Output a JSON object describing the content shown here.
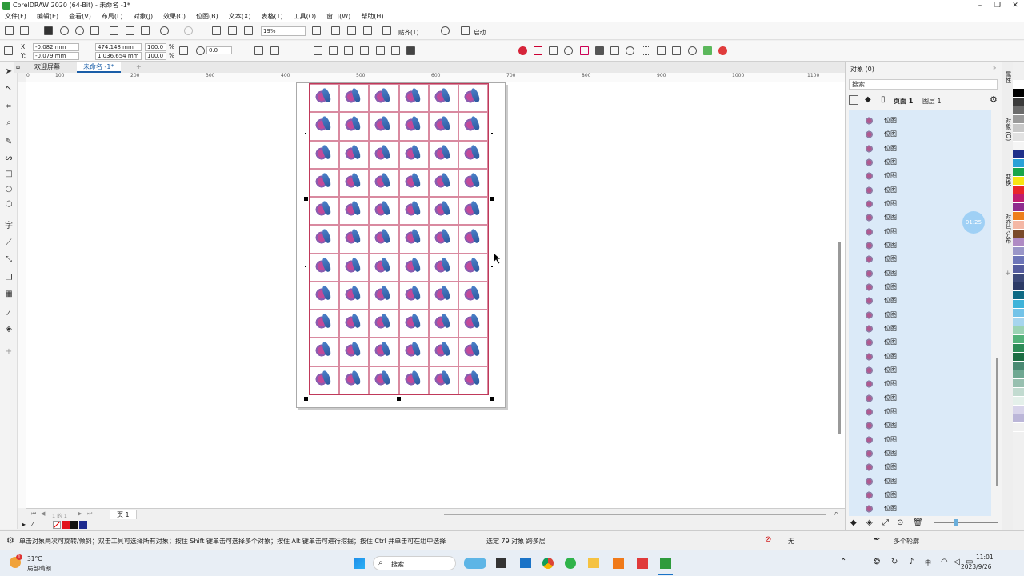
{
  "window": {
    "title": "CorelDRAW 2020 (64-Bit) - 未命名 -1*",
    "minimize": "–",
    "restore": "❐",
    "close": "✕"
  },
  "menu": [
    "文件(F)",
    "编辑(E)",
    "查看(V)",
    "布局(L)",
    "对象(J)",
    "效果(C)",
    "位图(B)",
    "文本(X)",
    "表格(T)",
    "工具(O)",
    "窗口(W)",
    "帮助(H)"
  ],
  "toolbar": {
    "zoom": "19%",
    "snap_label": "贴齐(T)",
    "launch_label": "启动"
  },
  "propbar": {
    "x_label": "X:",
    "x_value": "-0.082 mm",
    "y_label": "Y:",
    "y_value": "-0.079 mm",
    "w_value": "474.148 mm",
    "h_value": "1,036.654 mm",
    "sx_value": "100.0",
    "sy_value": "100.0",
    "pct": "%",
    "angle_value": "0.0"
  },
  "tabs": {
    "welcome": "欢迎屏幕",
    "document": "未命名 -1*"
  },
  "ruler_h": [
    "0",
    "100",
    "200",
    "300",
    "400",
    "500",
    "600",
    "700",
    "800",
    "900",
    "1000",
    "1100"
  ],
  "pagebar": {
    "counter": "1 的 1",
    "page_tab": "页 1"
  },
  "status": {
    "hint": "单击对象两次可旋转/倾斜；双击工具可选择所有对象；按住 Shift 键单击可选择多个对象；按住 Alt 键单击可进行挖掘；按住 Ctrl 并单击可在组中选择",
    "selection": "选定 79 对象 跨多层",
    "fill_label": "无",
    "outline_label": "多个轮廓"
  },
  "object_panel": {
    "title": "对象 (0)",
    "search_placeholder": "搜索",
    "page_label": "页面 1",
    "layer_label": "图层 1",
    "items": [
      "位图",
      "位图",
      "位图",
      "位图",
      "位图",
      "位图",
      "位图",
      "位图",
      "位图",
      "位图",
      "位图",
      "位图",
      "位图",
      "位图",
      "位图",
      "位图",
      "位图",
      "位图",
      "位图",
      "位图",
      "位图",
      "位图",
      "位图",
      "位图",
      "位图",
      "位图",
      "位图",
      "位图",
      "位图",
      "位图"
    ]
  },
  "side_tabs": [
    "属性",
    "对象 (O)",
    "变换",
    "对齐与分布"
  ],
  "timer": "01:25",
  "palette": [
    "#ffffff",
    "#000000",
    "#3a3a3a",
    "#6b6b6b",
    "#9a9a9a",
    "#c8c8c8",
    "#e2e2e2",
    "#f5f5f5",
    "#1f2f8a",
    "#2aa1d8",
    "#18a54a",
    "#f7e512",
    "#e9262a",
    "#c01d6f",
    "#8f2b8e",
    "#ee7f1c",
    "#f4b7a5",
    "#7a4a2a",
    "#b08bc4",
    "#9a96c8",
    "#6d75b8",
    "#555c9e",
    "#3d4a7a",
    "#2c3b66",
    "#0f6a84",
    "#3fb3d9",
    "#73c3e8",
    "#a6d5ee",
    "#9bd3b4",
    "#53b27a",
    "#2d8c57",
    "#1c6e43",
    "#4a8a73",
    "#6fa892",
    "#98c0b0",
    "#c2dbd0",
    "#e4f0ea",
    "#d8d4ea",
    "#bbb6d8",
    "#f0f0f0"
  ],
  "taskbar": {
    "weather_temp": "31°C",
    "weather_desc": "局部晴朗",
    "weather_badge": "1",
    "search": "搜索",
    "time": "11:01",
    "date": "2023/9/26",
    "ime": "中"
  }
}
